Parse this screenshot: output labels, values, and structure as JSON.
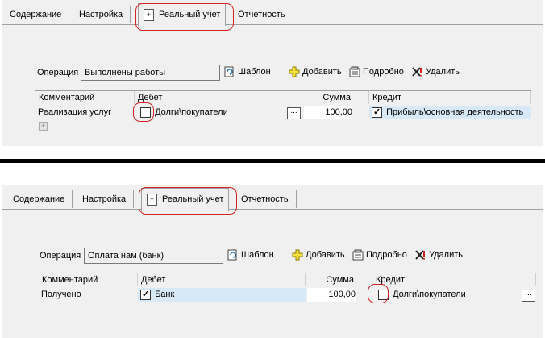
{
  "tabs": [
    "Содержание",
    "Настройка",
    "Реальный учет",
    "Отчетность"
  ],
  "toolbar": {
    "operation_label": "Операция",
    "template": "Шаблон",
    "add": "Добавить",
    "details": "Подробно",
    "delete": "Удалить"
  },
  "columns": [
    "Комментарий",
    "Дебет",
    "Сумма",
    "Кредит"
  ],
  "columns2": [
    "Комментарий",
    "Дебет",
    "Сумма",
    "Кредит"
  ],
  "panel1": {
    "operation_value": "Выполнены работы",
    "row": {
      "comment": "Реализация услуг",
      "debit": "Долги\\покупатели",
      "amount": "100,00",
      "credit": "Прибыль\\основная деятельность"
    }
  },
  "panel2": {
    "operation_value": "Оплата нам (банк)",
    "row": {
      "comment": "Получено",
      "debit": "Банк",
      "amount": "100,00",
      "credit": "Долги\\покупатели"
    }
  },
  "ellipsis": "...",
  "accent_color": "#d32222",
  "selection_color": "#d7e8f7"
}
